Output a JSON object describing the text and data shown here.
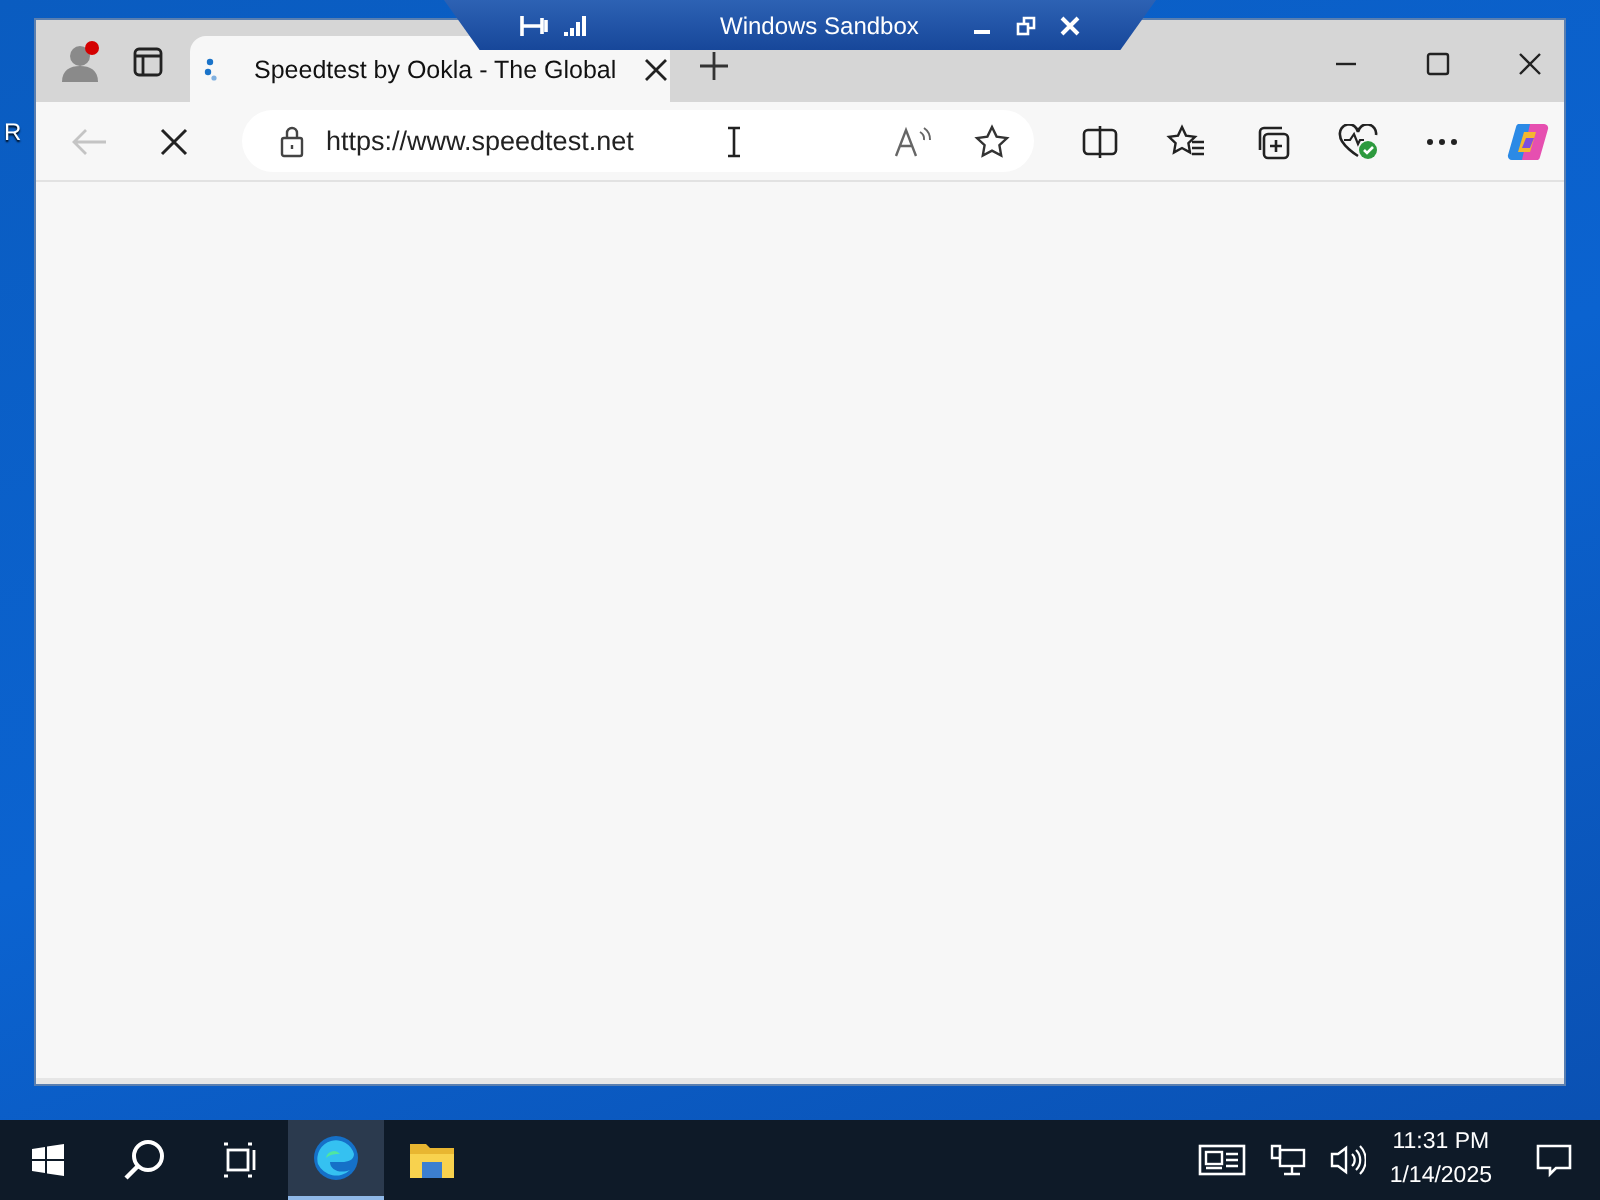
{
  "desktop": {
    "icon_label": "R"
  },
  "sandbox_bar": {
    "title": "Windows Sandbox"
  },
  "browser": {
    "profile_notification": true,
    "tabs": [
      {
        "title": "Speedtest by Ookla - The Global",
        "selected": true,
        "loading": true
      }
    ],
    "loading": true,
    "address": {
      "value": "https://www.speedtest.net"
    }
  },
  "taskbar": {
    "apps": [
      {
        "kind": "edge",
        "active": true
      },
      {
        "kind": "explorer",
        "active": false
      }
    ],
    "time": "11:31 PM",
    "date": "1/14/2025"
  }
}
